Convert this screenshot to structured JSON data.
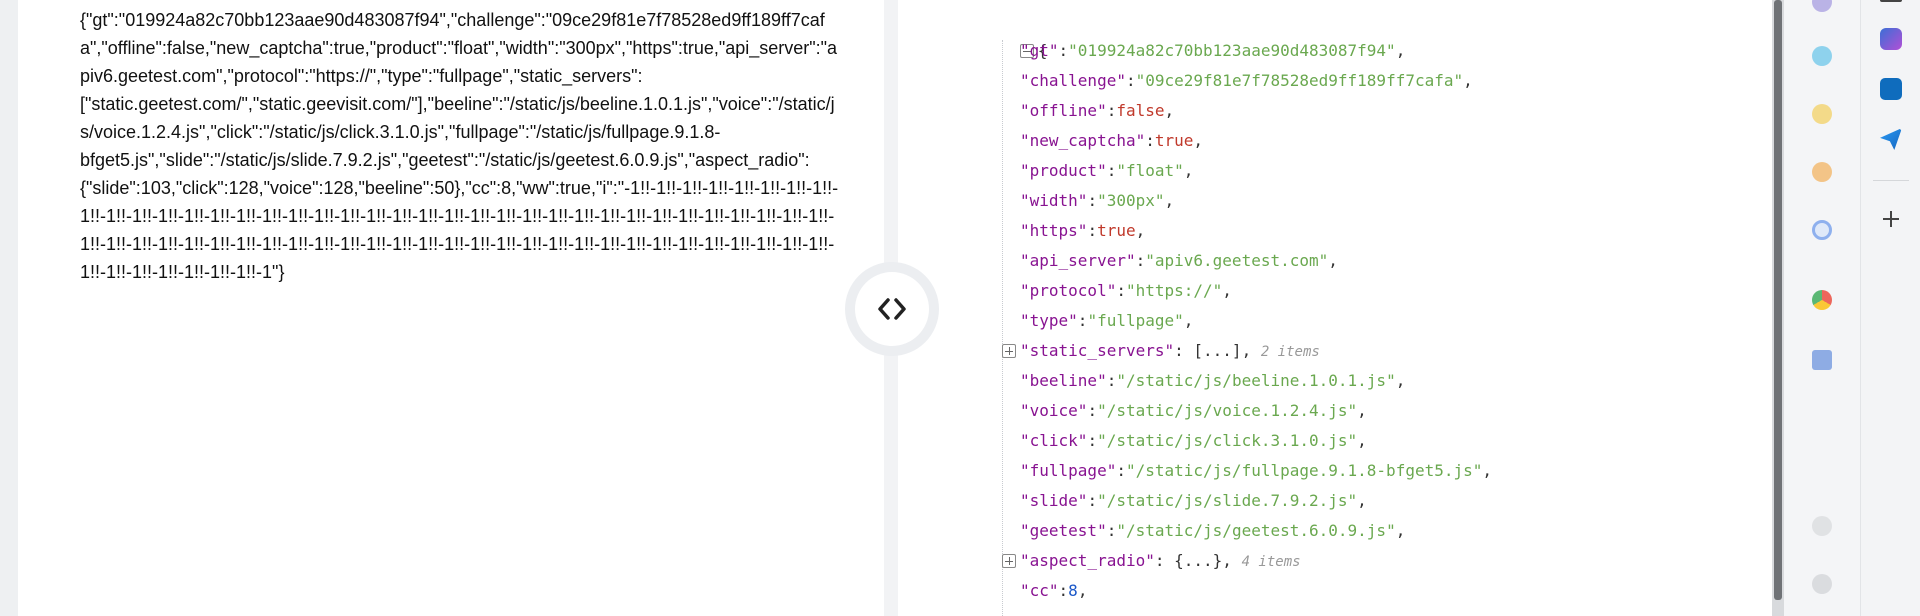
{
  "raw_json_text": "{\"gt\":\"019924a82c70bb123aae90d483087f94\",\"challenge\":\"09ce29f81e7f78528ed9ff189ff7cafa\",\"offline\":false,\"new_captcha\":true,\"product\":\"float\",\"width\":\"300px\",\"https\":true,\"api_server\":\"apiv6.geetest.com\",\"protocol\":\"https://\",\"type\":\"fullpage\",\"static_servers\":\n[\"static.geetest.com/\",\"static.geevisit.com/\"],\"beeline\":\"/static/js/beeline.1.0.1.js\",\"voice\":\"/static/js/voice.1.2.4.js\",\"click\":\"/static/js/click.3.1.0.js\",\"fullpage\":\"/static/js/fullpage.9.1.8-\nbfget5.js\",\"slide\":\"/static/js/slide.7.9.2.js\",\"geetest\":\"/static/js/geetest.6.0.9.js\",\"aspect_radio\":\n{\"slide\":103,\"click\":128,\"voice\":128,\"beeline\":50},\"cc\":8,\"ww\":true,\"i\":\"-1!!-1!!-1!!-1!!-1!!-1!!-1!!-1!!-1!!-1!!-1!!-1!!-1!!-1!!-1!!-1!!-1!!-1!!-1!!-1!!-1!!-1!!-1!!-1!!-1!!-1!!-1!!-1!!-1!!-1!!-1!!-1!!-1!!-1!!-1!!-1!!-1!!-1!!-1!!-1!!-1!!-1!!-1!!-1!!-1!!-1!!-1!!-1!!-1!!-1!!-1!!-1!!-1!!-1!!-1!!-1!!-1!!-1!!-1!!-1!!-1!!-1!!-1!!-1!!-1!!-1!!-1!!-1!!-1!!-1!!-1!!-1!!-1!!-1\"}",
  "tree": {
    "open_brace": "{",
    "rows": [
      {
        "key": "\"gt\"",
        "value": "\"019924a82c70bb123aae90d483087f94\"",
        "vtype": "s"
      },
      {
        "key": "\"challenge\"",
        "value": "\"09ce29f81e7f78528ed9ff189ff7cafa\"",
        "vtype": "s"
      },
      {
        "key": "\"offline\"",
        "value": "false",
        "vtype": "b"
      },
      {
        "key": "\"new_captcha\"",
        "value": "true",
        "vtype": "b"
      },
      {
        "key": "\"product\"",
        "value": "\"float\"",
        "vtype": "s"
      },
      {
        "key": "\"width\"",
        "value": "\"300px\"",
        "vtype": "s"
      },
      {
        "key": "\"https\"",
        "value": "true",
        "vtype": "b"
      },
      {
        "key": "\"api_server\"",
        "value": "\"apiv6.geetest.com\"",
        "vtype": "s"
      },
      {
        "key": "\"protocol\"",
        "value": "\"https://\"",
        "vtype": "s"
      },
      {
        "key": "\"type\"",
        "value": "\"fullpage\"",
        "vtype": "s"
      },
      {
        "key": "\"static_servers\"",
        "value": "[...]",
        "vtype": "collapsed",
        "count": "2 items"
      },
      {
        "key": "\"beeline\"",
        "value": "\"/static/js/beeline.1.0.1.js\"",
        "vtype": "s"
      },
      {
        "key": "\"voice\"",
        "value": "\"/static/js/voice.1.2.4.js\"",
        "vtype": "s"
      },
      {
        "key": "\"click\"",
        "value": "\"/static/js/click.3.1.0.js\"",
        "vtype": "s"
      },
      {
        "key": "\"fullpage\"",
        "value": "\"/static/js/fullpage.9.1.8-bfget5.js\"",
        "vtype": "s"
      },
      {
        "key": "\"slide\"",
        "value": "\"/static/js/slide.7.9.2.js\"",
        "vtype": "s"
      },
      {
        "key": "\"geetest\"",
        "value": "\"/static/js/geetest.6.0.9.js\"",
        "vtype": "s"
      },
      {
        "key": "\"aspect_radio\"",
        "value": "{...}",
        "vtype": "collapsed",
        "count": "4 items"
      },
      {
        "key": "\"cc\"",
        "value": "8",
        "vtype": "n"
      }
    ]
  },
  "icons": {
    "toggle": "code-brackets-icon",
    "extension_column": [
      "extension-icon-1",
      "extension-icon-2",
      "extension-icon-3",
      "extension-icon-4",
      "extension-icon-5",
      "chrome-icon",
      "graduation-icon",
      "moon-icon",
      "chat-icon"
    ],
    "sidebar": [
      "copilot-icon",
      "outlook-icon",
      "send-icon",
      "add-icon"
    ]
  },
  "colors": {
    "key": "#881391",
    "string": "#6aa84f",
    "boolean": "#c0392b",
    "number": "#1a57c8"
  }
}
